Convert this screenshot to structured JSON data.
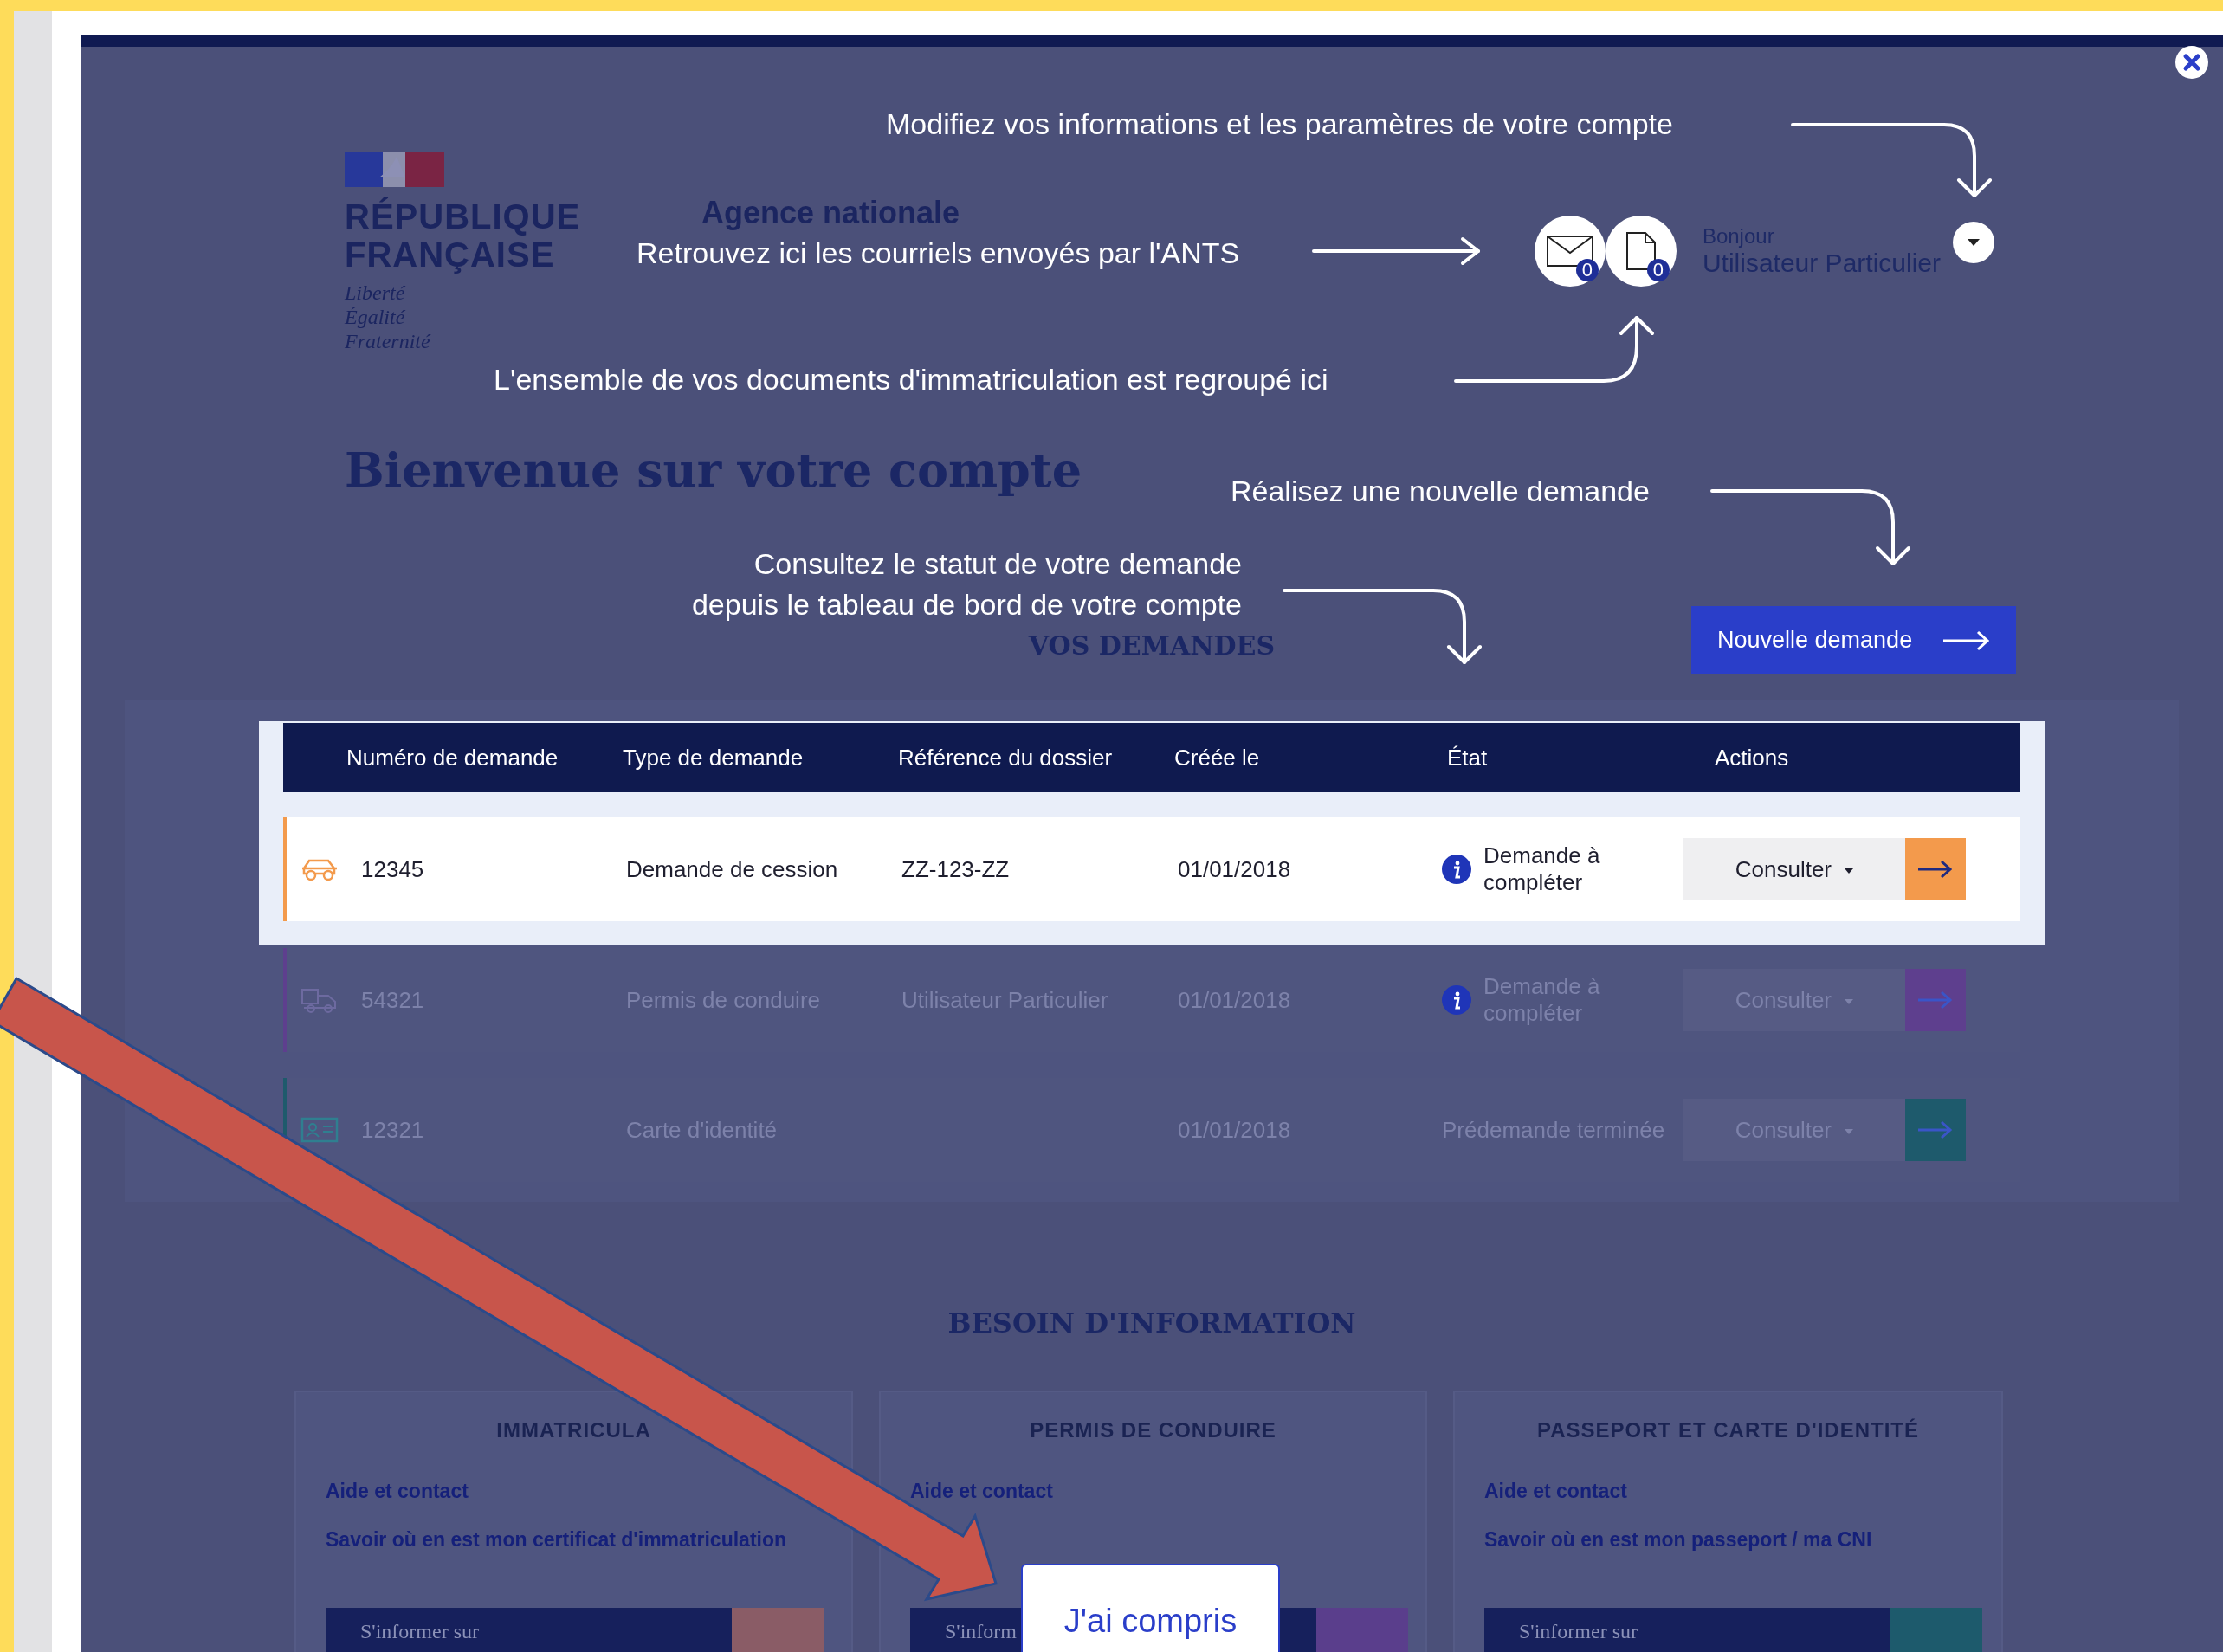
{
  "header": {
    "logo_lines": [
      "RÉPUBLIQUE",
      "FRANÇAISE"
    ],
    "motto": [
      "Liberté",
      "Égalité",
      "Fraternité"
    ],
    "agency": "Agence nationale",
    "mail_count": "0",
    "documents_count": "0",
    "greeting": "Bonjour",
    "user_name": "Utilisateur Particulier"
  },
  "heading": "Bienvenue sur votre compte",
  "requests_title": "VOS DEMANDES",
  "new_request_button": "Nouvelle demande",
  "table": {
    "columns": [
      "Numéro de demande",
      "Type de demande",
      "Référence du dossier",
      "Créée le",
      "État",
      "Actions"
    ],
    "rows": [
      {
        "kind": "car",
        "number": "12345",
        "type": "Demande de cession",
        "reference": "ZZ-123-ZZ",
        "created": "01/01/2018",
        "status": "Demande à compléter",
        "status_icon": true,
        "action": "Consulter",
        "highlighted": true,
        "color": "#f39a4c"
      },
      {
        "kind": "license",
        "number": "54321",
        "type": "Permis de conduire",
        "reference": "Utilisateur Particulier",
        "created": "01/01/2018",
        "status": "Demande à compléter",
        "status_icon": true,
        "action": "Consulter",
        "highlighted": false,
        "color": "#5e3f8e"
      },
      {
        "kind": "id_card",
        "number": "12321",
        "type": "Carte d'identité",
        "created": "01/01/2018",
        "status": "Prédemande terminée",
        "status_icon": false,
        "action": "Consulter",
        "highlighted": false,
        "color": "#1e5a6c"
      }
    ]
  },
  "info_title": "BESOIN D'INFORMATION",
  "info_cards": [
    {
      "title": "IMMATRICULA",
      "links": [
        "Aide et contact",
        "Savoir où en est mon certificat d'immatriculation"
      ],
      "button": "S'informer sur",
      "color": "#8a5c66"
    },
    {
      "title": "PERMIS DE CONDUIRE",
      "links": [
        "Aide et contact"
      ],
      "button": "S'inform",
      "color": "#5a3e8c"
    },
    {
      "title": "PASSEPORT ET CARTE D'IDENTITÉ",
      "links": [
        "Aide et contact",
        "Savoir où en est mon passeport / ma CNI"
      ],
      "button": "S'informer sur",
      "color": "#1d5a6c"
    }
  ],
  "callouts": [
    {
      "kind": "account",
      "text": "Modifiez vos informations et les paramètres de votre compte"
    },
    {
      "kind": "mail",
      "text": "Retrouvez ici les courriels envoyés par l'ANTS"
    },
    {
      "kind": "documents",
      "text": "L'ensemble de vos documents d'immatriculation est regroupé ici"
    },
    {
      "kind": "new_request",
      "text": "Réalisez une nouvelle demande"
    },
    {
      "kind": "status",
      "text": "Consultez le statut de votre demande\ndepuis le tableau de bord de votre compte"
    }
  ],
  "confirm_button": "J'ai compris"
}
